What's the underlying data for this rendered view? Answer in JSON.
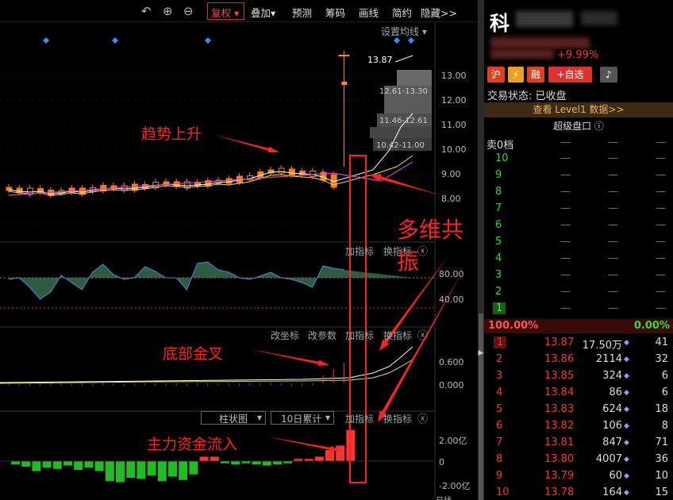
{
  "toolbar": {
    "fq_label": "复权",
    "overlay_label": "叠加",
    "predict_label": "预测",
    "chip_label": "筹码",
    "draw_label": "画线",
    "simple_label": "简约",
    "hide_label": "隐藏>>"
  },
  "main_chart": {
    "ma_setting": "设置均线",
    "y_ticks": [
      "13.00",
      "12.00",
      "11.00",
      "10.00",
      "9.00",
      "8.00"
    ],
    "last_price": "13.87",
    "chip_bands": [
      "12.61-13.30",
      "11.46-12.61",
      "10.42-11.00"
    ]
  },
  "sub1": {
    "add": "加指标",
    "change": "换指标",
    "y_ticks": [
      "80.00",
      "40.00"
    ]
  },
  "sub2": {
    "coord": "改坐标",
    "param": "改参数",
    "add": "加指标",
    "change": "换指标",
    "y_ticks": [
      "0.600",
      "0.000"
    ]
  },
  "sub3": {
    "type": "柱状图",
    "accum": "10日累计",
    "add": "加指标",
    "change": "换指标",
    "y_ticks": [
      "2.00亿",
      "0",
      "-2.00亿"
    ],
    "values": [
      -0.3,
      -0.5,
      -0.9,
      -0.6,
      -0.7,
      -0.4,
      -0.8,
      -0.6,
      -0.9,
      -1.8,
      -1.9,
      -1.5,
      -1.6,
      -1.3,
      -1.8,
      -1.4,
      -1.7,
      -1.2,
      0.4,
      0.4,
      -0.2,
      -0.3,
      -0.2,
      -0.3,
      -0.4,
      -0.3,
      -0.2,
      0.2,
      0.2,
      0.4,
      1.0,
      1.4,
      2.8
    ],
    "bottom_dates": [
      "日线"
    ]
  },
  "annotations": {
    "trend": "趋势上升",
    "resonance": "多维共振",
    "golden": "底部金叉",
    "inflow": "主力资金流入"
  },
  "panel": {
    "title_char": "科",
    "change_pct": "+9.99%",
    "badges": [
      "沪",
      "融"
    ],
    "add_fav": "+自选",
    "status": "交易状态: 已收盘",
    "level1": "查看 Level1 数据>>",
    "super_disk": "超级盘口",
    "sell0": "卖0档",
    "sell_levels": [
      "10",
      "9",
      "8",
      "7",
      "6",
      "5",
      "4",
      "3",
      "2",
      "1"
    ],
    "dash": "—",
    "buy_ratio": "100.00%",
    "sell_ratio": "0.00%",
    "bids": [
      {
        "i": "1",
        "p": "13.87",
        "v": "17.50万",
        "c": "41"
      },
      {
        "i": "2",
        "p": "13.86",
        "v": "2114",
        "c": "32"
      },
      {
        "i": "3",
        "p": "13.85",
        "v": "324",
        "c": "6"
      },
      {
        "i": "4",
        "p": "13.84",
        "v": "86",
        "c": "6"
      },
      {
        "i": "5",
        "p": "13.83",
        "v": "624",
        "c": "18"
      },
      {
        "i": "6",
        "p": "13.82",
        "v": "106",
        "c": "8"
      },
      {
        "i": "7",
        "p": "13.81",
        "v": "847",
        "c": "71"
      },
      {
        "i": "8",
        "p": "13.80",
        "v": "4007",
        "c": "36"
      },
      {
        "i": "9",
        "p": "13.79",
        "v": "60",
        "c": "10"
      },
      {
        "i": "10",
        "p": "13.78",
        "v": "164",
        "c": "15"
      }
    ]
  },
  "colors": {
    "up": "#ff3333",
    "down": "#22bb22",
    "accent": "#ff2222"
  }
}
